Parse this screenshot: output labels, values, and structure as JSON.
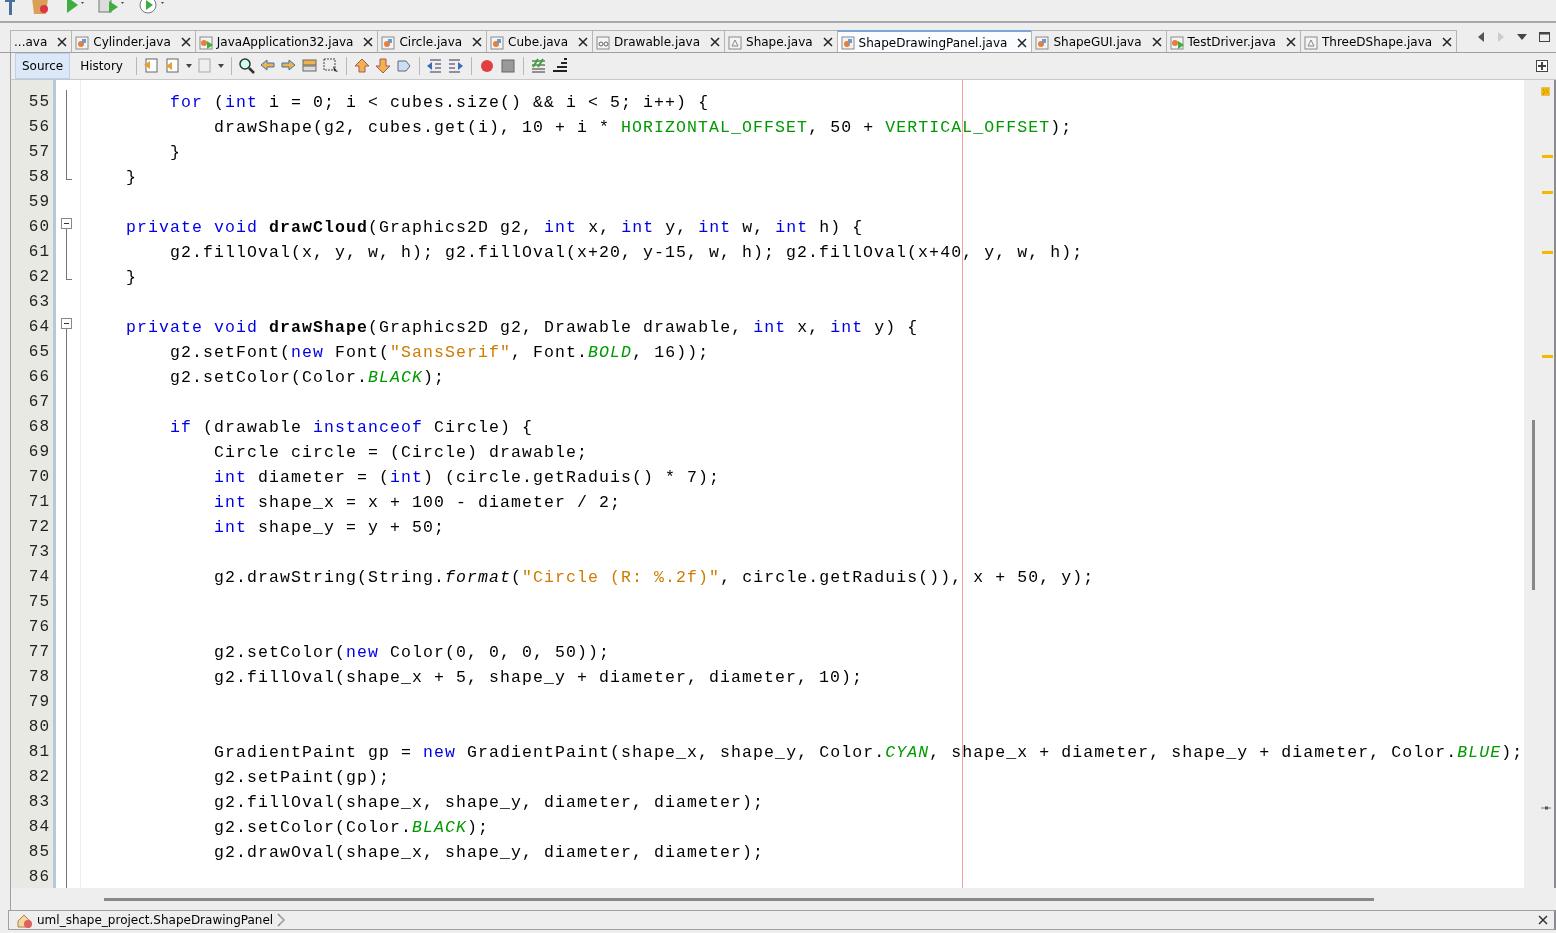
{
  "tabs": [
    {
      "label": "...ava",
      "kind": "none",
      "selected": false
    },
    {
      "label": "Cylinder.java",
      "kind": "class",
      "selected": false
    },
    {
      "label": "JavaApplication32.java",
      "kind": "main",
      "selected": false
    },
    {
      "label": "Circle.java",
      "kind": "class",
      "selected": false
    },
    {
      "label": "Cube.java",
      "kind": "class",
      "selected": false
    },
    {
      "label": "Drawable.java",
      "kind": "interface",
      "selected": false
    },
    {
      "label": "Shape.java",
      "kind": "abstract",
      "selected": false
    },
    {
      "label": "ShapeDrawingPanel.java",
      "kind": "class",
      "selected": true
    },
    {
      "label": "ShapeGUI.java",
      "kind": "class",
      "selected": false
    },
    {
      "label": "TestDriver.java",
      "kind": "main",
      "selected": false
    },
    {
      "label": "ThreeDShape.java",
      "kind": "abstract",
      "selected": false
    }
  ],
  "editor_toolbar": {
    "views": [
      {
        "label": "Source",
        "selected": true
      },
      {
        "label": "History",
        "selected": false
      }
    ]
  },
  "code": {
    "lines": [
      {
        "number": "55",
        "kind": "fold-body",
        "tokens": [
          {
            "kind": "keyword",
            "text": "        for"
          },
          {
            "kind": "plain",
            "text": " ("
          },
          {
            "kind": "keyword",
            "text": "int"
          },
          {
            "kind": "plain",
            "text": " i = 0; i < cubes.size() && i < 5; i++) {"
          }
        ]
      },
      {
        "number": "56",
        "kind": "fold-body",
        "tokens": [
          {
            "kind": "plain",
            "text": "            drawShape(g2, cubes.get(i), 10 + i * "
          },
          {
            "kind": "field",
            "text": "HORIZONTAL_OFFSET"
          },
          {
            "kind": "plain",
            "text": ", 50 + "
          },
          {
            "kind": "field",
            "text": "VERTICAL_OFFSET"
          },
          {
            "kind": "plain",
            "text": ");"
          }
        ]
      },
      {
        "number": "57",
        "kind": "fold-body",
        "tokens": [
          {
            "kind": "plain",
            "text": "        }"
          }
        ]
      },
      {
        "number": "58",
        "kind": "fold-end",
        "tokens": [
          {
            "kind": "plain",
            "text": "    }"
          }
        ]
      },
      {
        "number": "59",
        "kind": "plain"
      },
      {
        "number": "60",
        "kind": "fold-start",
        "tokens": [
          {
            "kind": "keyword",
            "text": "    private"
          },
          {
            "kind": "keyword",
            "text": " void"
          },
          {
            "kind": "method",
            "text": " drawCloud"
          },
          {
            "kind": "plain",
            "text": "(Graphics2D g2, "
          },
          {
            "kind": "keyword",
            "text": "int"
          },
          {
            "kind": "plain",
            "text": " x, "
          },
          {
            "kind": "keyword",
            "text": "int"
          },
          {
            "kind": "plain",
            "text": " y, "
          },
          {
            "kind": "keyword",
            "text": "int"
          },
          {
            "kind": "plain",
            "text": " w, "
          },
          {
            "kind": "keyword",
            "text": "int"
          },
          {
            "kind": "plain",
            "text": " h) {"
          }
        ]
      },
      {
        "number": "61",
        "kind": "fold-body",
        "tokens": [
          {
            "kind": "plain",
            "text": "        g2.fillOval(x, y, w, h); g2.fillOval(x+20, y-15, w, h); g2.fillOval(x+40, y, w, h);"
          }
        ]
      },
      {
        "number": "62",
        "kind": "fold-end",
        "tokens": [
          {
            "kind": "plain",
            "text": "    }"
          }
        ]
      },
      {
        "number": "63",
        "kind": "plain"
      },
      {
        "number": "64",
        "kind": "fold-start",
        "tokens": [
          {
            "kind": "keyword",
            "text": "    private"
          },
          {
            "kind": "keyword",
            "text": " void"
          },
          {
            "kind": "method",
            "text": " drawShape"
          },
          {
            "kind": "plain",
            "text": "(Graphics2D g2, Drawable drawable, "
          },
          {
            "kind": "keyword",
            "text": "int"
          },
          {
            "kind": "plain",
            "text": " x, "
          },
          {
            "kind": "keyword",
            "text": "int"
          },
          {
            "kind": "plain",
            "text": " y) {"
          }
        ]
      },
      {
        "number": "65",
        "kind": "fold-body",
        "tokens": [
          {
            "kind": "plain",
            "text": "        g2.setFont("
          },
          {
            "kind": "keyword",
            "text": "new"
          },
          {
            "kind": "plain",
            "text": " Font("
          },
          {
            "kind": "string",
            "text": "\"SansSerif\""
          },
          {
            "kind": "plain",
            "text": ", Font."
          },
          {
            "kind": "static",
            "text": "BOLD"
          },
          {
            "kind": "plain",
            "text": ", 16));"
          }
        ]
      },
      {
        "number": "66",
        "kind": "fold-body",
        "tokens": [
          {
            "kind": "plain",
            "text": "        g2.setColor(Color."
          },
          {
            "kind": "static",
            "text": "BLACK"
          },
          {
            "kind": "plain",
            "text": ");"
          }
        ]
      },
      {
        "number": "67",
        "kind": "fold-body"
      },
      {
        "number": "68",
        "kind": "fold-body",
        "tokens": [
          {
            "kind": "keyword",
            "text": "        if"
          },
          {
            "kind": "plain",
            "text": " (drawable "
          },
          {
            "kind": "keyword",
            "text": "instanceof"
          },
          {
            "kind": "plain",
            "text": " Circle) {"
          }
        ]
      },
      {
        "number": "69",
        "kind": "fold-body",
        "tokens": [
          {
            "kind": "plain",
            "text": "            Circle circle = (Circle) drawable;"
          }
        ]
      },
      {
        "number": "70",
        "kind": "fold-body",
        "tokens": [
          {
            "kind": "keyword",
            "text": "            int"
          },
          {
            "kind": "plain",
            "text": " diameter = ("
          },
          {
            "kind": "keyword",
            "text": "int"
          },
          {
            "kind": "plain",
            "text": ") (circle.getRaduis() * 7);"
          }
        ]
      },
      {
        "number": "71",
        "kind": "fold-body",
        "tokens": [
          {
            "kind": "keyword",
            "text": "            int"
          },
          {
            "kind": "plain",
            "text": " shape_x = x + 100 - diameter / 2;"
          }
        ]
      },
      {
        "number": "72",
        "kind": "fold-body",
        "tokens": [
          {
            "kind": "keyword",
            "text": "            int"
          },
          {
            "kind": "plain",
            "text": " shape_y = y + 50;"
          }
        ]
      },
      {
        "number": "73",
        "kind": "fold-body"
      },
      {
        "number": "74",
        "kind": "fold-body",
        "tokens": [
          {
            "kind": "plain",
            "text": "            g2.drawString(String."
          },
          {
            "kind": "static-method",
            "text": "format"
          },
          {
            "kind": "plain",
            "text": "("
          },
          {
            "kind": "string",
            "text": "\"Circle (R: %.2f)\""
          },
          {
            "kind": "plain",
            "text": ", circle.getRaduis()), x + 50, y);"
          }
        ]
      },
      {
        "number": "75",
        "kind": "fold-body"
      },
      {
        "number": "76",
        "kind": "fold-body"
      },
      {
        "number": "77",
        "kind": "fold-body",
        "tokens": [
          {
            "kind": "plain",
            "text": "            g2.setColor("
          },
          {
            "kind": "keyword",
            "text": "new"
          },
          {
            "kind": "plain",
            "text": " Color(0, 0, 0, 50));"
          }
        ]
      },
      {
        "number": "78",
        "kind": "fold-body",
        "tokens": [
          {
            "kind": "plain",
            "text": "            g2.fillOval(shape_x + 5, shape_y + diameter, diameter, 10);"
          }
        ]
      },
      {
        "number": "79",
        "kind": "fold-body"
      },
      {
        "number": "80",
        "kind": "fold-body"
      },
      {
        "number": "81",
        "kind": "fold-body",
        "tokens": [
          {
            "kind": "plain",
            "text": "            GradientPaint gp = "
          },
          {
            "kind": "keyword",
            "text": "new"
          },
          {
            "kind": "plain",
            "text": " GradientPaint(shape_x, shape_y, Color."
          },
          {
            "kind": "static",
            "text": "CYAN"
          },
          {
            "kind": "plain",
            "text": ", shape_x + diameter, shape_y + diameter, Color."
          },
          {
            "kind": "static",
            "text": "BLUE"
          },
          {
            "kind": "plain",
            "text": ");"
          }
        ]
      },
      {
        "number": "82",
        "kind": "fold-body",
        "tokens": [
          {
            "kind": "plain",
            "text": "            g2.setPaint(gp);"
          }
        ]
      },
      {
        "number": "83",
        "kind": "fold-body",
        "tokens": [
          {
            "kind": "plain",
            "text": "            g2.fillOval(shape_x, shape_y, diameter, diameter);"
          }
        ]
      },
      {
        "number": "84",
        "kind": "fold-body",
        "tokens": [
          {
            "kind": "plain",
            "text": "            g2.setColor(Color."
          },
          {
            "kind": "static",
            "text": "BLACK"
          },
          {
            "kind": "plain",
            "text": ");"
          }
        ]
      },
      {
        "number": "85",
        "kind": "fold-body",
        "tokens": [
          {
            "kind": "plain",
            "text": "            g2.drawOval(shape_x, shape_y, diameter, diameter);"
          }
        ]
      },
      {
        "number": "86",
        "kind": "fold-body"
      }
    ]
  },
  "breadcrumb": {
    "path": "uml_shape_project.ShapeDrawingPanel"
  }
}
